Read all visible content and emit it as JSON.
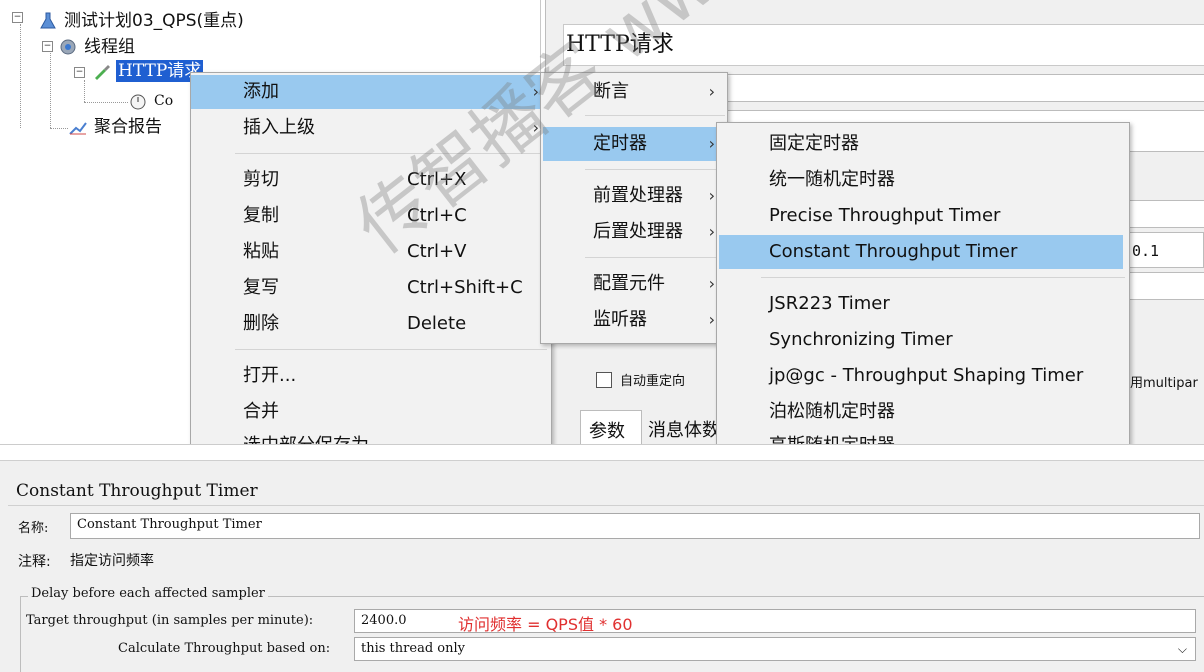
{
  "tree": {
    "items": [
      {
        "label": "测试计划03_QPS(重点)"
      },
      {
        "label": "线程组"
      },
      {
        "label": "HTTP请求"
      },
      {
        "label": "Co"
      },
      {
        "label": "聚合报告"
      }
    ]
  },
  "http_panel": {
    "title": "HTTP请求",
    "value_fragment": "0.1",
    "auto_redirect": "自动重定向",
    "multipart": "用multipar",
    "tab_params": "参数",
    "tab_body": "消息体数"
  },
  "context_menu": {
    "items": [
      {
        "label": "添加"
      },
      {
        "label": "插入上级"
      },
      {
        "label": "剪切",
        "shortcut": "Ctrl+X"
      },
      {
        "label": "复制",
        "shortcut": "Ctrl+C"
      },
      {
        "label": "粘贴",
        "shortcut": "Ctrl+V"
      },
      {
        "label": "复写",
        "shortcut": "Ctrl+Shift+C"
      },
      {
        "label": "删除",
        "shortcut": "Delete"
      },
      {
        "label": "打开..."
      },
      {
        "label": "合并"
      },
      {
        "label": "选中部分保存为"
      }
    ]
  },
  "add_submenu": {
    "items": [
      {
        "label": "断言"
      },
      {
        "label": "定时器"
      },
      {
        "label": "前置处理器"
      },
      {
        "label": "后置处理器"
      },
      {
        "label": "配置元件"
      },
      {
        "label": "监听器"
      }
    ]
  },
  "timer_submenu": {
    "items": [
      {
        "label": "固定定时器"
      },
      {
        "label": "统一随机定时器"
      },
      {
        "label": "Precise Throughput Timer"
      },
      {
        "label": "Constant Throughput Timer"
      },
      {
        "label": "JSR223 Timer"
      },
      {
        "label": "Synchronizing Timer"
      },
      {
        "label": "jp@gc - Throughput Shaping Timer"
      },
      {
        "label": "泊松随机定时器"
      },
      {
        "label": "高斯随机定时器"
      }
    ]
  },
  "timer_panel": {
    "title": "Constant Throughput Timer",
    "name_label": "名称:",
    "name_value": "Constant Throughput Timer",
    "comment_label": "注释:",
    "comment_value": "指定访问频率",
    "group_legend": "Delay before each affected sampler",
    "target_label": "Target throughput (in samples per minute):",
    "target_value": "2400.0",
    "annotation": "访问频率 = QPS值 * 60",
    "calc_label": "Calculate Throughput based on:",
    "calc_value": "this thread only"
  },
  "watermark": "传智播客 www.itcast.cn",
  "colors": {
    "selection": "#1f5fd1",
    "menu_highlight": "#99c9ef",
    "annotation": "#e03030"
  }
}
